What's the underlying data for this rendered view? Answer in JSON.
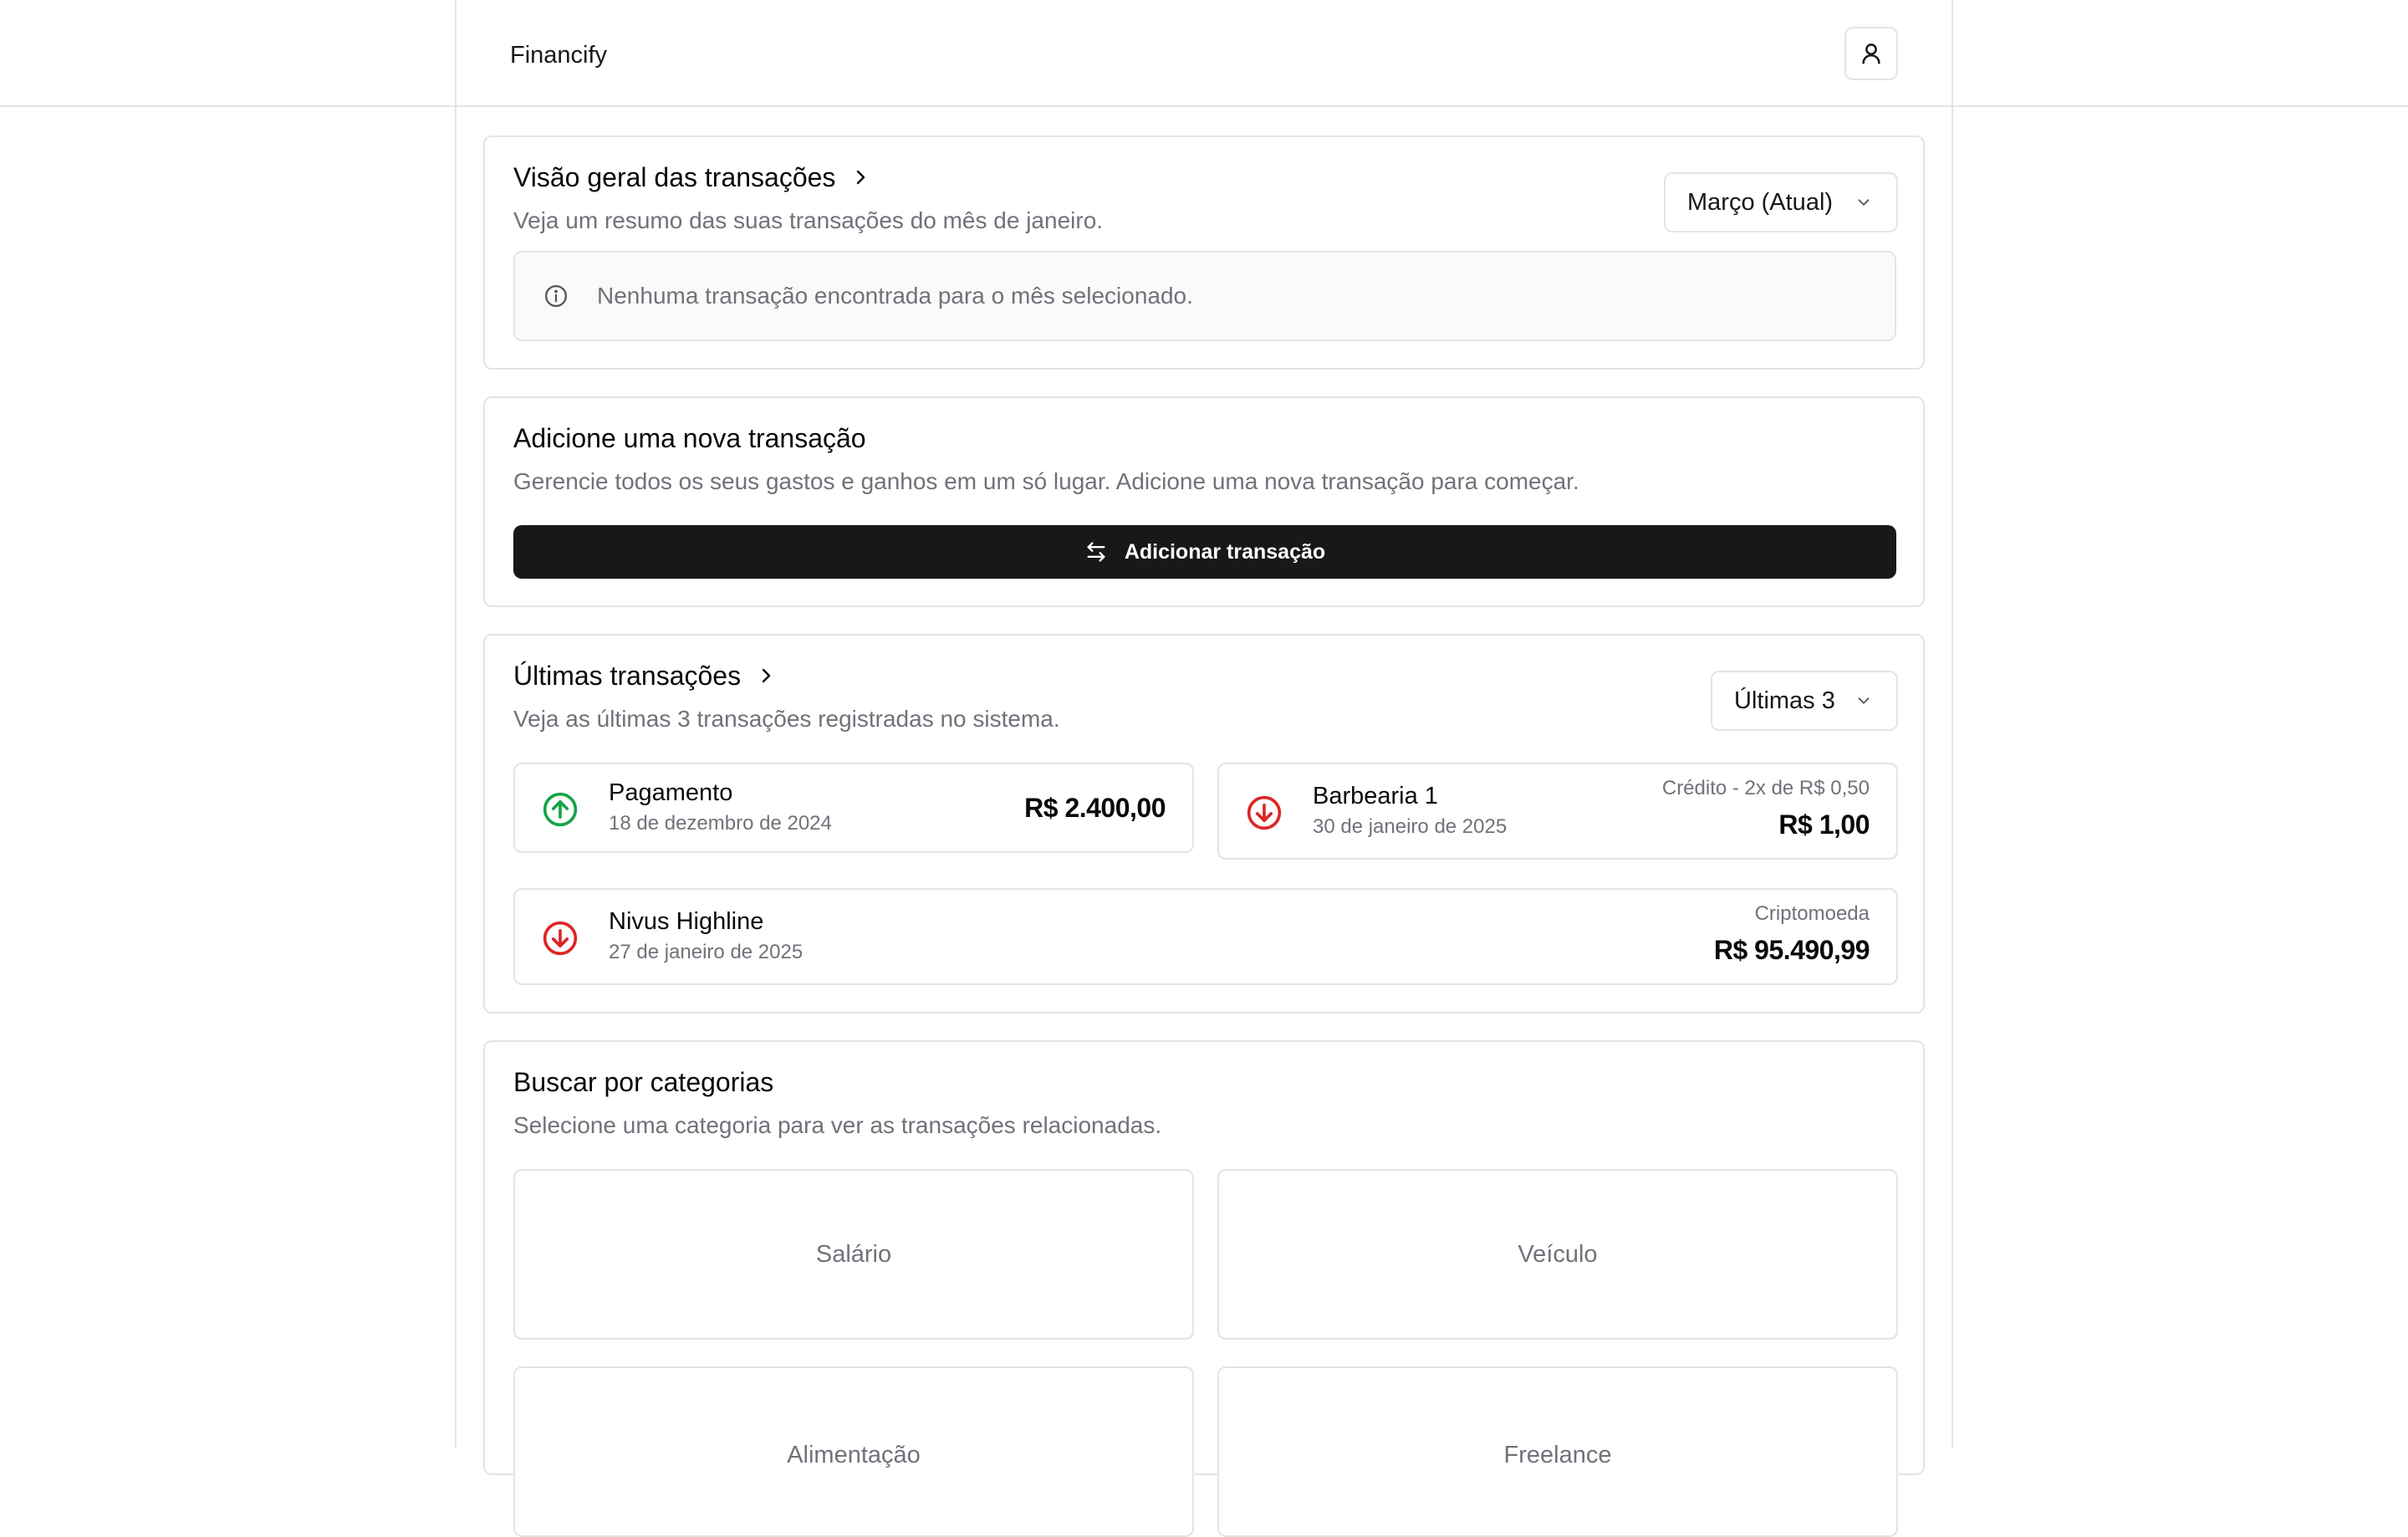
{
  "app": {
    "brand": "Financify"
  },
  "overview": {
    "title": "Visão geral das transações",
    "description": "Veja um resumo das suas transações do mês de janeiro.",
    "month_select": "Março (Atual)",
    "empty_message": "Nenhuma transação encontrada para o mês selecionado."
  },
  "add": {
    "title": "Adicione uma nova transação",
    "description": "Gerencie todos os seus gastos e ganhos em um só lugar. Adicione uma nova transação para começar.",
    "button_label": "Adicionar transação"
  },
  "latest": {
    "title": "Últimas transações",
    "description": "Veja as últimas 3 transações registradas no sistema.",
    "count_select": "Últimas 3",
    "items": [
      {
        "name": "Pagamento",
        "date": "18 de dezembro de 2024",
        "amount": "R$ 2.400,00",
        "detail": "",
        "direction": "income",
        "color": "#16a34a"
      },
      {
        "name": "Barbearia 1",
        "date": "30 de janeiro de 2025",
        "amount": "R$ 1,00",
        "detail": "Crédito - 2x de R$ 0,50",
        "direction": "expense",
        "color": "#dc2626"
      },
      {
        "name": "Nivus Highline",
        "date": "27 de janeiro de 2025",
        "amount": "R$ 95.490,99",
        "detail": "Criptomoeda",
        "direction": "expense",
        "color": "#dc2626"
      }
    ]
  },
  "categories": {
    "title": "Buscar por categorias",
    "description": "Selecione uma categoria para ver as transações relacionadas.",
    "items": [
      "Salário",
      "Veículo",
      "Alimentação",
      "Freelance"
    ]
  }
}
